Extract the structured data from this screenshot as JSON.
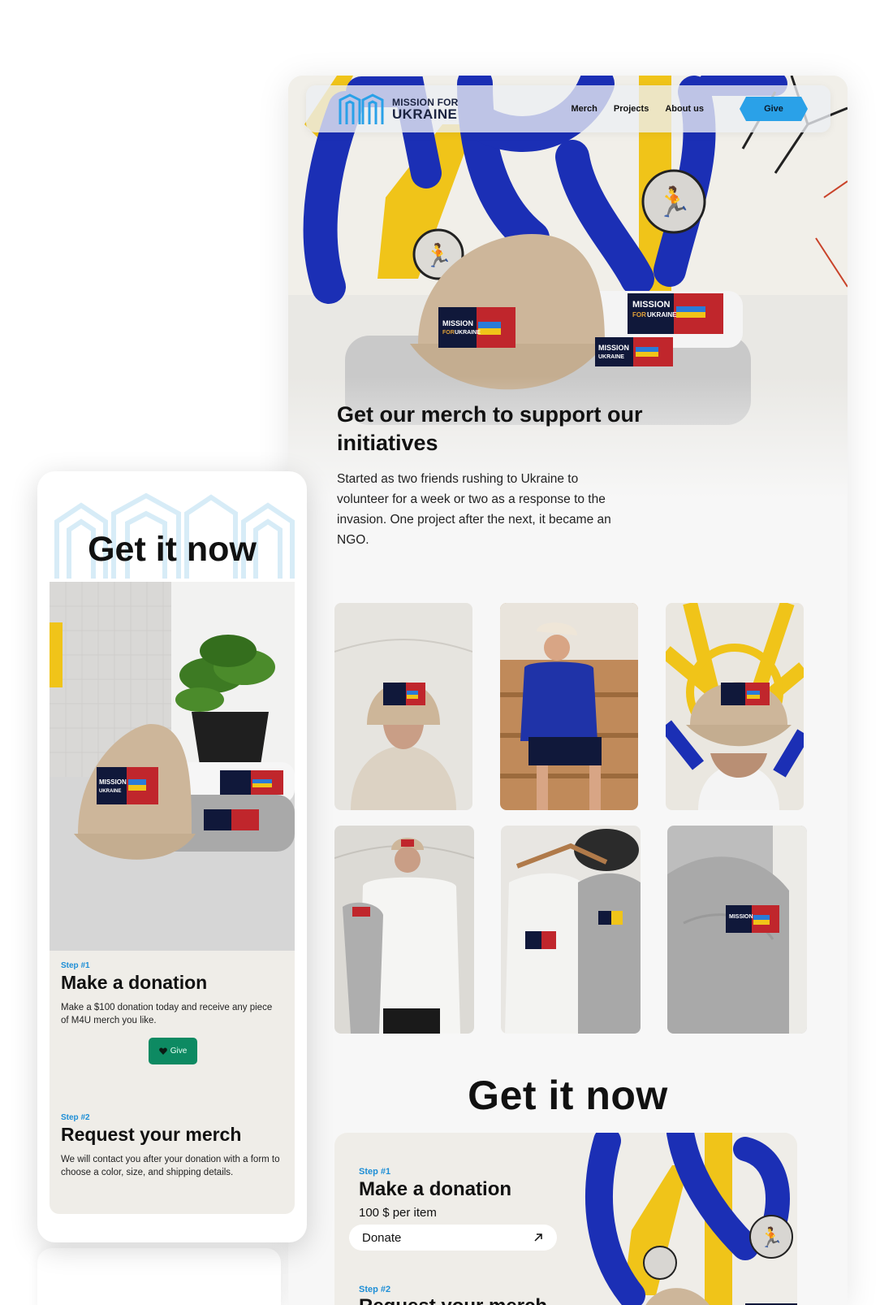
{
  "brand": {
    "line1": "MISSION FOR",
    "line2": "UKRAINE",
    "primary": "#2aa1e8",
    "navy": "#1b2340"
  },
  "nav": {
    "links": [
      "Merch",
      "Projects",
      "About us"
    ],
    "give_label": "Give"
  },
  "hero": {
    "title": "Get our merch to support our initiatives",
    "description": "Started as two friends rushing to Ukraine to volunteer for a week or two as a response to the invasion. One project after the next, it became an NGO."
  },
  "merch_patch": {
    "line1": "MISSION",
    "line2_a": "FOR",
    "line2_b": "UKRAINE"
  },
  "get_it": {
    "heading": "Get it now",
    "step1": {
      "label": "Step #1",
      "title": "Make a donation",
      "price": "100 $ per item",
      "button": "Donate",
      "icon": "arrow-up-right-icon"
    },
    "step2": {
      "label": "Step #2",
      "title": "Request your merch"
    }
  },
  "mobile": {
    "heading": "Get it now",
    "step1": {
      "label": "Step #1",
      "title": "Make a donation",
      "description": "Make a $100 donation today and receive any piece of M4U merch you like.",
      "button": "Give",
      "icon": "heart-icon",
      "button_color": "#0d8a62"
    },
    "step2": {
      "label": "Step #2",
      "title": "Request your merch",
      "description": "We will contact you after your donation with a form to choose a color, size, and shipping details."
    }
  }
}
